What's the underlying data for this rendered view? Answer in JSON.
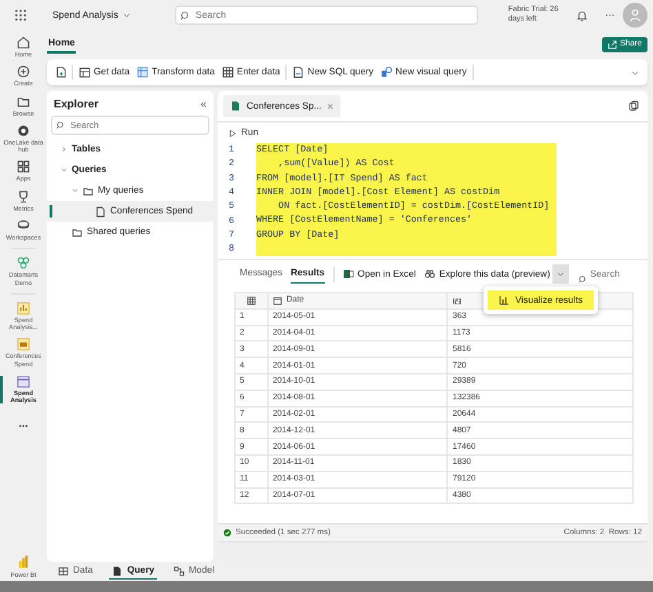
{
  "top_bar": {
    "workspace": "Spend Analysis",
    "search": {
      "placeholder": "Search"
    },
    "trial": "Fabric Trial: 26 days left",
    "more": "···"
  },
  "rail": {
    "items": [
      {
        "label": "Home",
        "kind": "home",
        "selected": false
      },
      {
        "label": "Create",
        "kind": "create",
        "selected": false
      },
      {
        "label": "Browse",
        "kind": "browse",
        "selected": false
      },
      {
        "label": "OneLake data hub",
        "kind": "hub",
        "selected": false
      },
      {
        "label": "Apps",
        "kind": "apps",
        "selected": false
      },
      {
        "label": "Metrics",
        "kind": "metrics",
        "selected": false
      },
      {
        "label": "Workspaces",
        "kind": "workspaces",
        "selected": false
      },
      {
        "label": "Datamarts Demo",
        "kind": "datamart",
        "selected": false
      },
      {
        "label": "Spend Analysis...",
        "kind": "report",
        "selected": false
      },
      {
        "label": "Conferences Spend",
        "kind": "model",
        "selected": false
      },
      {
        "label": "Spend Analysis",
        "kind": "warehouse",
        "selected": true
      }
    ],
    "more": "...",
    "product": "Power BI"
  },
  "ribbon": {
    "tabs": [
      {
        "label": "Home",
        "selected": true
      }
    ],
    "share": "Share",
    "actions": [
      {
        "kind": "new"
      },
      {
        "kind": "get",
        "label": "Get data"
      },
      {
        "kind": "transform",
        "label": "Transform data"
      },
      {
        "kind": "enter",
        "label": "Enter data"
      },
      {
        "kind": "sql",
        "label": "New SQL query"
      },
      {
        "kind": "visual",
        "label": "New visual query"
      }
    ]
  },
  "explorer": {
    "title": "Explorer",
    "collapse": "«",
    "search": {
      "placeholder": "Search"
    },
    "tree": [
      {
        "label": "Tables",
        "kind": "group",
        "expanded": false,
        "selected": false
      },
      {
        "label": "Queries",
        "kind": "group",
        "expanded": true,
        "selected": false,
        "children": [
          {
            "label": "My queries",
            "kind": "folder",
            "expanded": true,
            "selected": false,
            "children": [
              {
                "label": "Conferences Spend",
                "kind": "file",
                "selected": true
              }
            ]
          },
          {
            "label": "Shared queries",
            "kind": "folder",
            "selected": false
          }
        ]
      }
    ]
  },
  "query": {
    "tab": {
      "label": "Conferences Sp...",
      "close": "×"
    },
    "run": "Run",
    "code": [
      {
        "number": "1",
        "text": "SELECT [Date]",
        "selected": true
      },
      {
        "number": "2",
        "text": "    ,sum([Value]) AS Cost",
        "selected": true
      },
      {
        "number": "3",
        "text": "FROM [model].[IT Spend] AS fact",
        "selected": true
      },
      {
        "number": "4",
        "text": "INNER JOIN [model].[Cost Element] AS costDim",
        "selected": true
      },
      {
        "number": "5",
        "text": "    ON fact.[CostElementID] = costDim.[CostElementID]",
        "selected": true
      },
      {
        "number": "6",
        "text": "WHERE [CostElementName] = 'Conferences'",
        "selected": true
      },
      {
        "number": "7",
        "text": "GROUP BY [Date]",
        "selected": true
      },
      {
        "number": "8",
        "selected": true
      }
    ],
    "result_tabs": [
      {
        "label": "Messages",
        "selected": false
      },
      {
        "label": "Results",
        "selected": true
      }
    ],
    "actions": [
      {
        "kind": "excel",
        "label": "Open in Excel"
      },
      {
        "kind": "explore",
        "label": "Explore this data (preview)"
      }
    ],
    "search": {
      "placeholder": "Search"
    },
    "menu": {
      "items": [
        {
          "label": "Visualize results",
          "selected": true
        }
      ]
    },
    "table": {
      "columns": [
        {
          "kind": "index"
        },
        {
          "label": "Date",
          "kind": "date"
        },
        {
          "kind": "number"
        }
      ],
      "rows": [
        [
          "1",
          "2014-05-01",
          "363"
        ],
        [
          "2",
          "2014-04-01",
          "1173"
        ],
        [
          "3",
          "2014-09-01",
          "5816"
        ],
        [
          "4",
          "2014-01-01",
          "720"
        ],
        [
          "5",
          "2014-10-01",
          "29389"
        ],
        [
          "6",
          "2014-08-01",
          "132386"
        ],
        [
          "7",
          "2014-02-01",
          "20644"
        ],
        [
          "8",
          "2014-12-01",
          "4807"
        ],
        [
          "9",
          "2014-06-01",
          "17460"
        ],
        [
          "10",
          "2014-11-01",
          "1830"
        ],
        [
          "11",
          "2014-03-01",
          "79120"
        ],
        [
          "12",
          "2014-07-01",
          "4380"
        ]
      ]
    },
    "status": {
      "message": "Succeeded (1 sec 277 ms)",
      "counts": "Columns: 2  Rows: 12"
    }
  },
  "bottom_tabs": [
    {
      "label": "Data",
      "kind": "table",
      "selected": false
    },
    {
      "label": "Query",
      "kind": "query",
      "selected": true
    },
    {
      "label": "Model",
      "kind": "model",
      "selected": false
    }
  ]
}
